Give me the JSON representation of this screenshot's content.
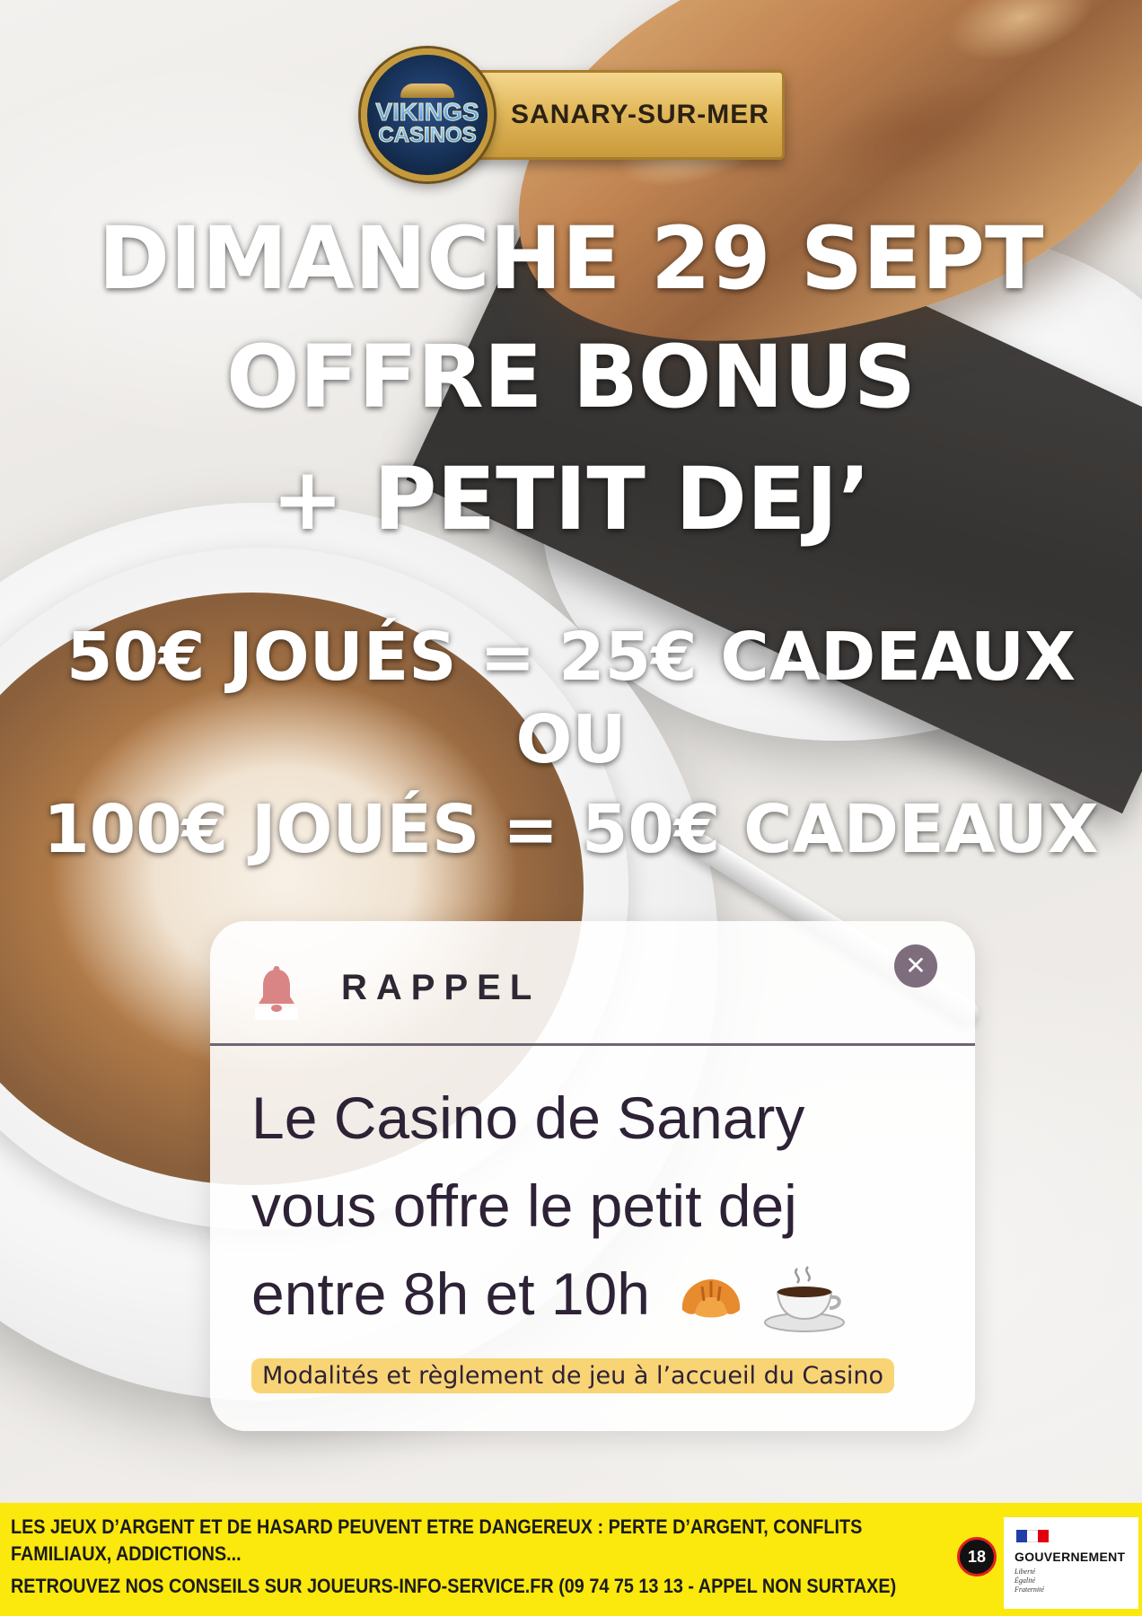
{
  "logo": {
    "brand_line1": "VIKINGS",
    "brand_line2": "CASINOS",
    "location": "SANARY-SUR-MER"
  },
  "headline": {
    "line1": "DIMANCHE 29 SEPT",
    "line2": "OFFRE BONUS",
    "line3": "+ PETIT DEJ’"
  },
  "offer": {
    "line1": "50€ JOUÉS = 25€ CADEAUX",
    "line2": "OU",
    "line3": "100€ JOUÉS = 50€ CADEAUX"
  },
  "reminder": {
    "title": "RAPPEL",
    "icon": "bell-icon",
    "close_icon": "close-icon",
    "body_line1": "Le Casino de Sanary",
    "body_line2": "vous offre le petit dej",
    "body_line3": "entre 8h et 10h",
    "emojis": [
      "croissant-icon",
      "coffee-icon"
    ],
    "note": "Modalités et règlement de jeu à l’accueil du Casino"
  },
  "footer": {
    "warning_line1": "LES JEUX D’ARGENT ET DE HASARD PEUVENT ETRE DANGEREUX : PERTE D’ARGENT, CONFLITS",
    "warning_line2": "FAMILIAUX, ADDICTIONS...",
    "warning_line3": "RETROUVEZ NOS CONSEILS SUR JOUEURS-INFO-SERVICE.FR (09 74 75 13 13 - APPEL NON SURTAXE)",
    "age_badge": "18",
    "gov_label": "GOUVERNEMENT",
    "gov_motto": [
      "Liberté",
      "Égalité",
      "Fraternité"
    ],
    "background_color": "#fbe80c"
  },
  "colors": {
    "headline_text": "#ffffff",
    "card_text": "#2e2236",
    "note_highlight": "#f8d475",
    "bell": "#d98585",
    "close_button": "#7d6d7d",
    "logo_gold": "#e2b95b",
    "logo_blue": "#12294a"
  }
}
